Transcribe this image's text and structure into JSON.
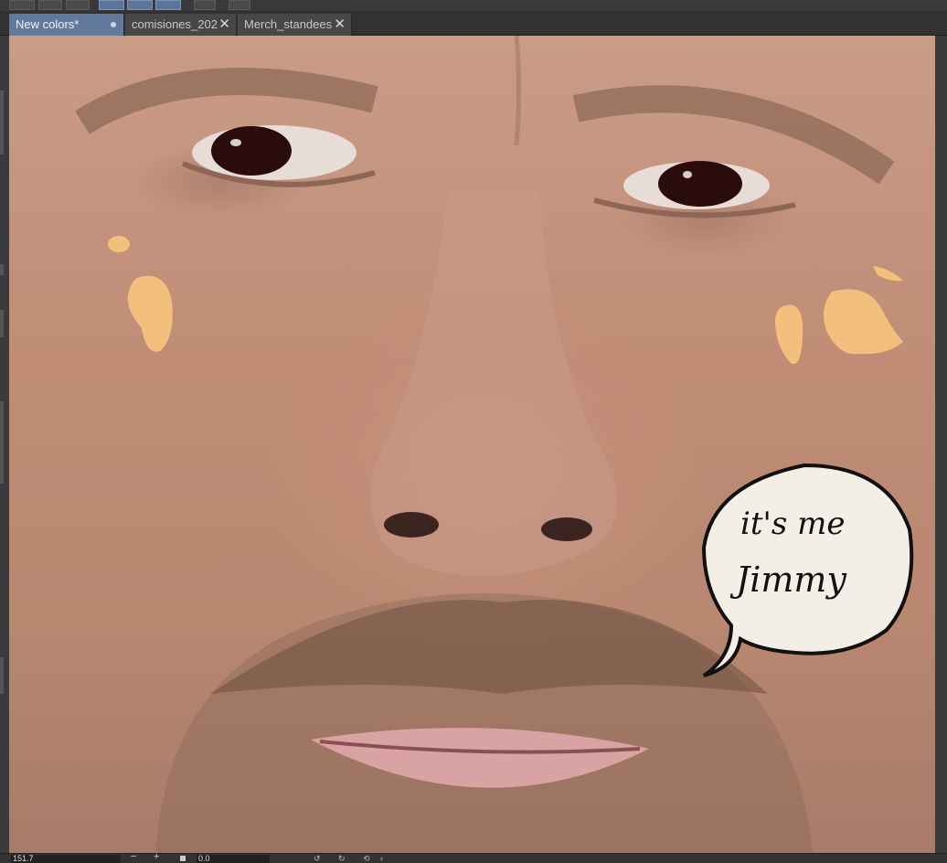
{
  "tabs": [
    {
      "label": "New colors*",
      "state": "modified"
    },
    {
      "label": "comisiones_202",
      "state": "closable"
    },
    {
      "label": "Merch_standees",
      "state": "closable"
    }
  ],
  "canvas": {
    "speech_bubble": {
      "line1": "it's me",
      "line2": "Jimmy"
    }
  },
  "statusbar": {
    "zoom_value": "151.7",
    "angle_value": "0.0"
  },
  "colors": {
    "accent_tab": "#61799d",
    "paint_strokes": "#f2c07c",
    "bubble_fill": "#f3efe6"
  },
  "icons": [
    "close-icon",
    "modified-dot-icon",
    "zoom-out-icon",
    "zoom-in-icon",
    "rotate-left-icon",
    "rotate-right-icon",
    "reset-view-icon"
  ]
}
